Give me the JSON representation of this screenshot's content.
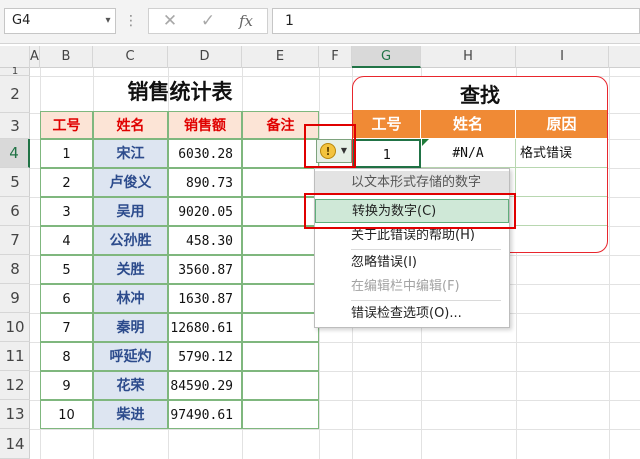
{
  "formula_bar": {
    "name_box": "G4",
    "cancel_icon": "✕",
    "enter_icon": "✓",
    "fx_label": "fx",
    "formula_value": "1"
  },
  "columns": [
    "A",
    "B",
    "C",
    "D",
    "E",
    "F",
    "G",
    "H",
    "I"
  ],
  "rows": [
    "1",
    "2",
    "3",
    "4",
    "5",
    "6",
    "7",
    "8",
    "9",
    "10",
    "11",
    "12",
    "13",
    "14"
  ],
  "sales_table": {
    "title": "销售统计表",
    "headers": [
      "工号",
      "姓名",
      "销售额",
      "备注"
    ],
    "rows": [
      {
        "id": "1",
        "name": "宋江",
        "amount": "6030.28"
      },
      {
        "id": "2",
        "name": "卢俊义",
        "amount": "890.73"
      },
      {
        "id": "3",
        "name": "吴用",
        "amount": "9020.05"
      },
      {
        "id": "4",
        "name": "公孙胜",
        "amount": "458.30"
      },
      {
        "id": "5",
        "name": "关胜",
        "amount": "3560.87"
      },
      {
        "id": "6",
        "name": "林冲",
        "amount": "1630.87"
      },
      {
        "id": "7",
        "name": "秦明",
        "amount": "12680.61"
      },
      {
        "id": "8",
        "name": "呼延灼",
        "amount": "5790.12"
      },
      {
        "id": "9",
        "name": "花荣",
        "amount": "84590.29"
      },
      {
        "id": "10",
        "name": "柴进",
        "amount": "97490.61"
      }
    ]
  },
  "lookup": {
    "title": "查找",
    "headers": [
      "工号",
      "姓名",
      "原因"
    ],
    "row": {
      "id": "1",
      "name": "#N/A",
      "reason": "格式错误"
    }
  },
  "error_menu": {
    "header": "以文本形式存储的数字",
    "items": [
      "转换为数字(C)",
      "关于此错误的帮助(H)",
      "忽略错误(I)",
      "在编辑栏中编辑(F)",
      "错误检查选项(O)..."
    ]
  },
  "colors": {
    "header_bg": "#fce4d6",
    "header_text": "#e00000",
    "name_bg": "#dde5f1",
    "lookup_header": "#f08a35",
    "highlight_red": "#e00000",
    "excel_green": "#217346"
  }
}
